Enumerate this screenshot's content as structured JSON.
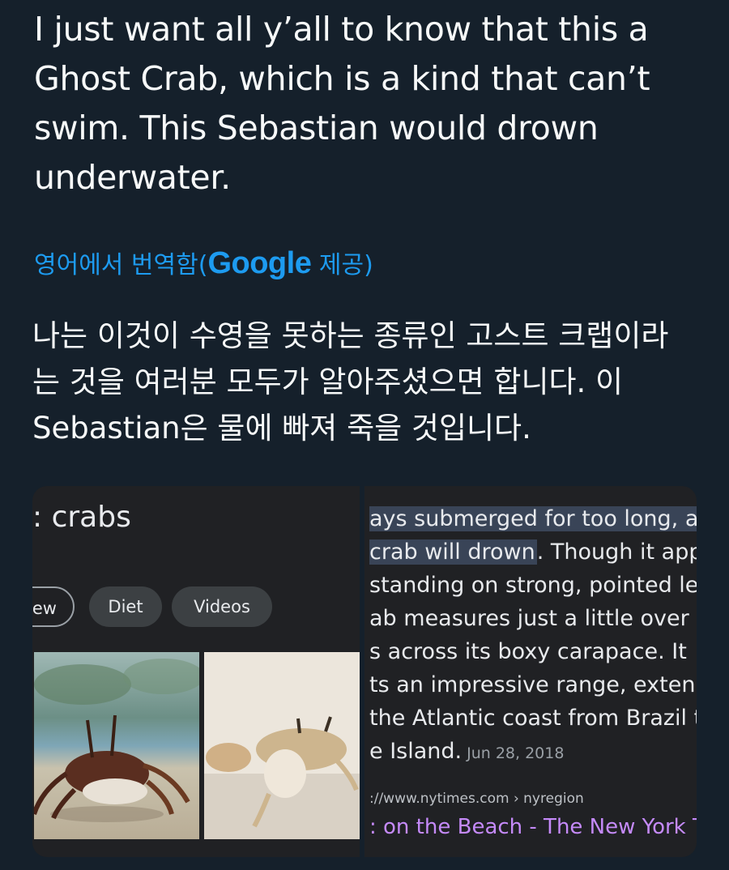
{
  "tweet": {
    "lines": [
      "I just want all y’all to know that this a",
      "Ghost Crab, which is a kind that can’t",
      "swim. This Sebastian would drown",
      "underwater."
    ]
  },
  "translation": {
    "prefix": "영어에서 번역함(",
    "google": "Google",
    "suffix": " 제공)",
    "lines": [
      "나는 이것이 수영을 못하는 종류인 고스트 크랩이라",
      "는 것을 여러분 모두가 알아주셨으면 합니다. 이",
      "Sebastian은 물에 빠져 죽을 것입니다."
    ]
  },
  "screenshot_left": {
    "title": ": crabs",
    "chips": [
      "ew",
      "Diet",
      "Videos"
    ]
  },
  "screenshot_right": {
    "snippet_lines": [
      {
        "highlight": "ays submerged for too long, a",
        "rest": ""
      },
      {
        "highlight": " crab will drown",
        "rest": ". Though it app"
      },
      {
        "highlight": "",
        "rest": " standing on strong, pointed leg"
      },
      {
        "highlight": "",
        "rest": "ab measures just a little over tw"
      },
      {
        "highlight": "",
        "rest": "s across its boxy carapace. It"
      },
      {
        "highlight": "",
        "rest": "ts an impressive range, extendi"
      },
      {
        "highlight": "",
        "rest": " the Atlantic coast from Brazil to"
      }
    ],
    "last_line": "e Island.",
    "date": "Jun 28, 2018",
    "url": "://www.nytimes.com › nyregion",
    "link": ": on the Beach - The New York T"
  },
  "colors": {
    "background": "#15202b",
    "translate_blue": "#1d9bf0",
    "link_purple": "#c58af9"
  }
}
